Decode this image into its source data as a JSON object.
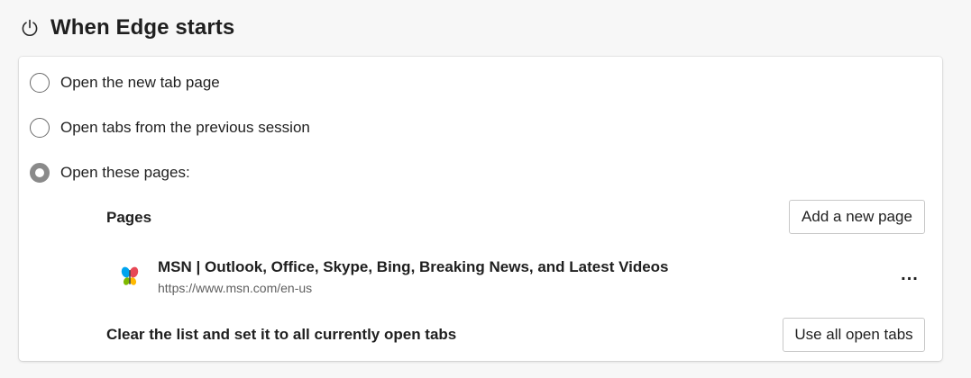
{
  "header": {
    "title": "When Edge starts",
    "icon": "power-icon"
  },
  "startup": {
    "options": [
      {
        "label": "Open the new tab page",
        "selected": false
      },
      {
        "label": "Open tabs from the previous session",
        "selected": false
      },
      {
        "label": "Open these pages:",
        "selected": true
      }
    ],
    "pages_label": "Pages",
    "add_page_label": "Add a new page",
    "pages": [
      {
        "title": "MSN | Outlook, Office, Skype, Bing, Breaking News, and Latest Videos",
        "url": "https://www.msn.com/en-us",
        "icon": "msn-butterfly-icon",
        "more_label": "..."
      }
    ],
    "clear_text": "Clear the list and set it to all currently open tabs",
    "use_tabs_label": "Use all open tabs"
  },
  "colors": {
    "background": "#f7f7f7",
    "card": "#ffffff",
    "radio_selected": "#8a8a8a",
    "url_text": "#5f5f5f"
  }
}
